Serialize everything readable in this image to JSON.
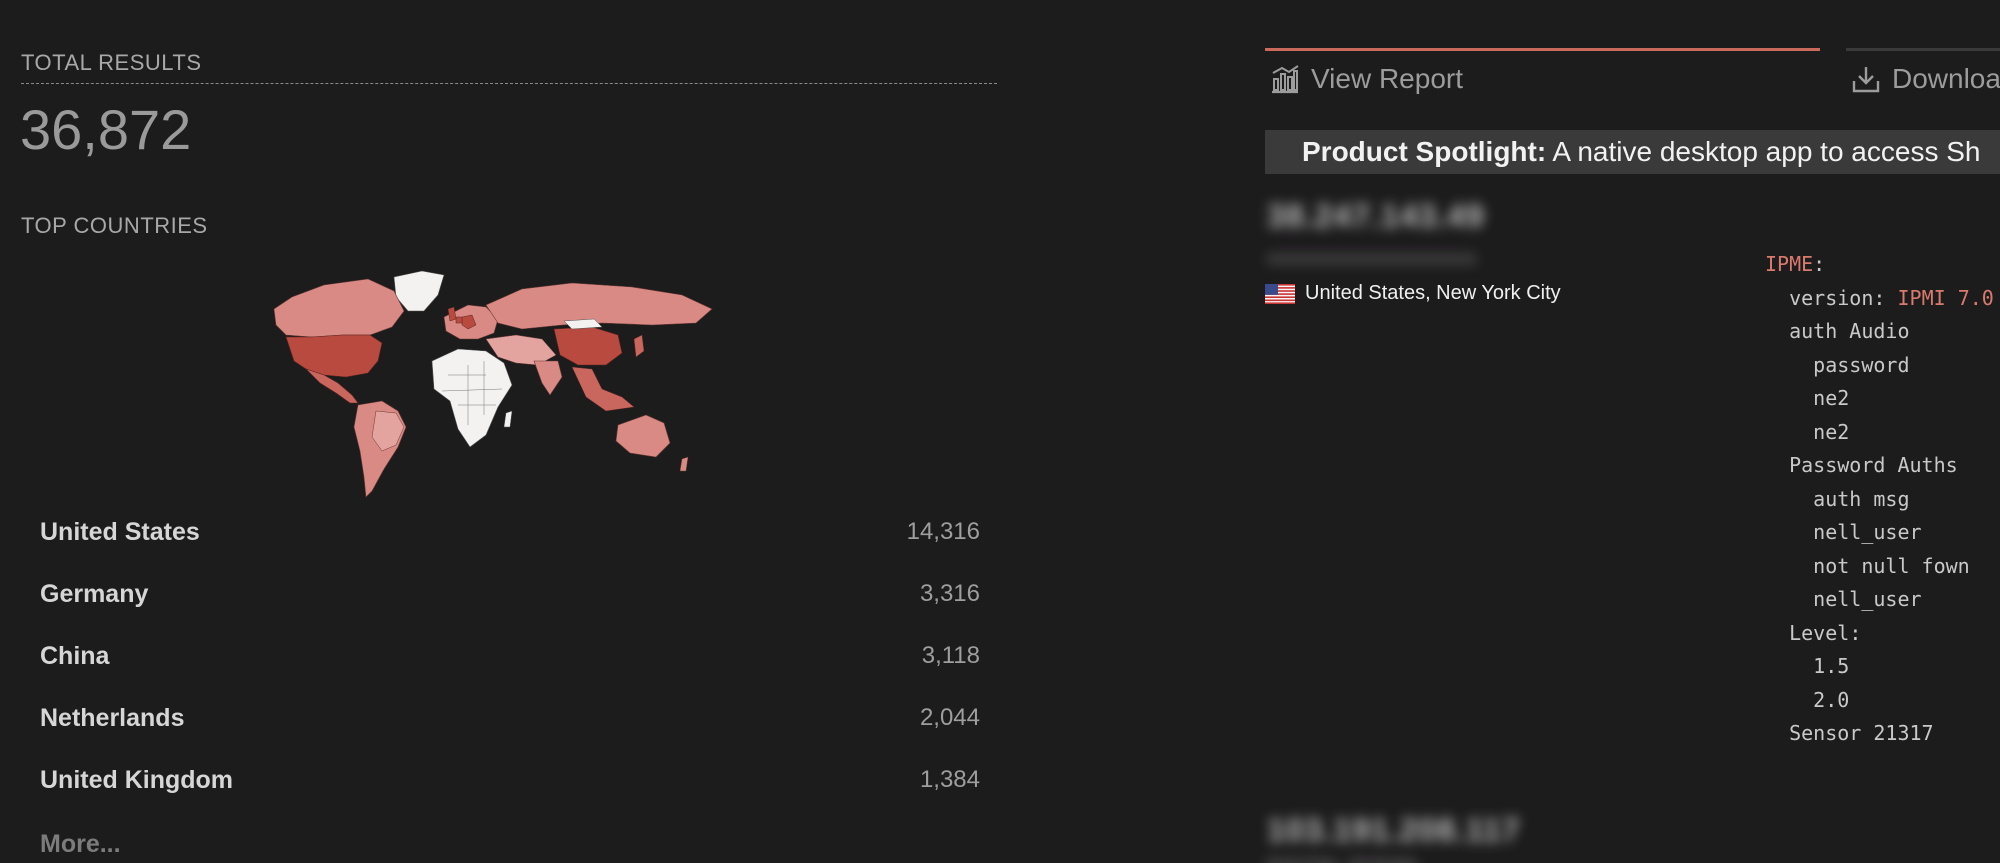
{
  "summary": {
    "total_label": "TOTAL RESULTS",
    "total_value": "36,872",
    "top_countries_label": "TOP COUNTRIES"
  },
  "countries": [
    {
      "name": "United States",
      "count": "14,316"
    },
    {
      "name": "Germany",
      "count": "3,316"
    },
    {
      "name": "China",
      "count": "3,118"
    },
    {
      "name": "Netherlands",
      "count": "2,044"
    },
    {
      "name": "United Kingdom",
      "count": "1,384"
    }
  ],
  "more_label": "More...",
  "tabs": {
    "view_report": "View Report",
    "download": "Downloa"
  },
  "spotlight": {
    "label": "Product Spotlight:",
    "text": "A native desktop app to access Sh"
  },
  "result": {
    "ip_blurred": "38.247.143.49",
    "hostname_blurred": "xxxxxxxxxxxxxxxxxxxxx",
    "location": "United States, New York City",
    "next_ip_blurred": "103.191.208.117",
    "next_sub_blurred": "DIGITAL OCEAN"
  },
  "banner_lines": [
    {
      "indent": 0,
      "key": "IPME",
      "sep": ":",
      "value": ""
    },
    {
      "indent": 1,
      "key": "version",
      "sep": ": ",
      "value": "IPMI 7.0"
    },
    {
      "indent": 1,
      "key": "auth Audio",
      "sep": "",
      "value": ""
    },
    {
      "indent": 2,
      "key": "password",
      "sep": "",
      "value": ""
    },
    {
      "indent": 2,
      "key": "ne2",
      "sep": "",
      "value": ""
    },
    {
      "indent": 2,
      "key": "ne2",
      "sep": "",
      "value": ""
    },
    {
      "indent": 1,
      "key": "Password Auths",
      "sep": "",
      "value": ""
    },
    {
      "indent": 2,
      "key": "auth msg",
      "sep": "",
      "value": ""
    },
    {
      "indent": 2,
      "key": "nell_user",
      "sep": "",
      "value": ""
    },
    {
      "indent": 2,
      "key": "not null fown",
      "sep": "",
      "value": ""
    },
    {
      "indent": 2,
      "key": "nell_user",
      "sep": "",
      "value": ""
    },
    {
      "indent": 1,
      "key": "Level",
      "sep": ":",
      "value": ""
    },
    {
      "indent": 2,
      "key": "1.5",
      "sep": "",
      "value": ""
    },
    {
      "indent": 2,
      "key": "2.0",
      "sep": "",
      "value": ""
    },
    {
      "indent": 1,
      "key": "Sensor 21317",
      "sep": "",
      "value": ""
    }
  ],
  "colors": {
    "background": "#1d1c1d",
    "accent": "#c96a5c",
    "map_dark": "#b94a40",
    "map_mid": "#d98a84",
    "map_light": "#f3e6e4"
  },
  "icons": {
    "view_report": "bar-chart-icon",
    "download": "download-icon",
    "flag": "us-flag-icon"
  }
}
